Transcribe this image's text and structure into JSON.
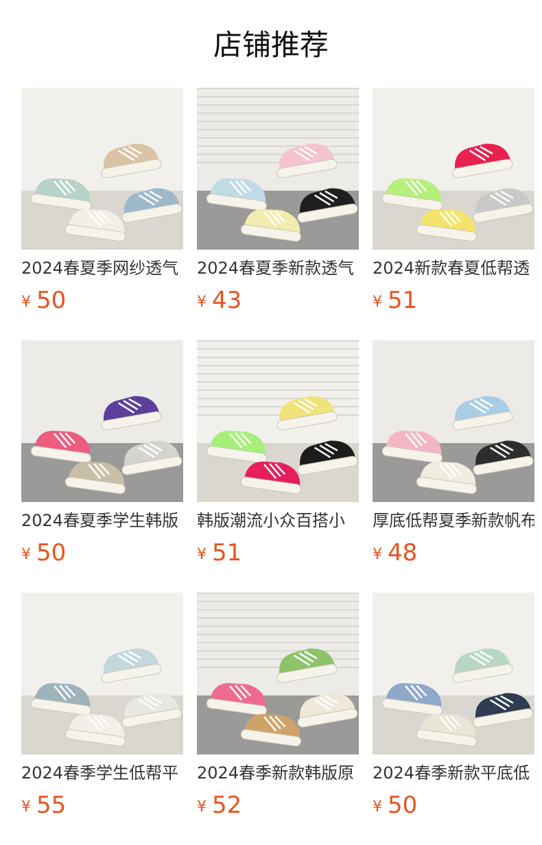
{
  "header": {
    "title": "店铺推荐"
  },
  "currency_symbol": "¥",
  "products": [
    {
      "name": "2024春夏季网纱透气",
      "price": "50",
      "image": "sneakers-pastel-pile-photo",
      "colors": [
        "#b7d3c9",
        "#d9c4a3",
        "#f2efe6",
        "#9db8c9"
      ]
    },
    {
      "name": "2024春夏季新款透气",
      "price": "43",
      "image": "canvas-sneakers-pile-photo",
      "colors": [
        "#bfdbe6",
        "#f4c3cf",
        "#f3ecb0",
        "#1f1f1f"
      ]
    },
    {
      "name": "2024新款春夏低帮透",
      "price": "51",
      "image": "colorful-sneakers-photo",
      "colors": [
        "#b5f07a",
        "#e8214f",
        "#f3e36a",
        "#c9c9c9"
      ]
    },
    {
      "name": "2024春夏季学生韩版",
      "price": "50",
      "image": "retro-sneakers-photo",
      "colors": [
        "#ee5c7f",
        "#5b3f9a",
        "#c9bfa8",
        "#d4d4d0"
      ]
    },
    {
      "name": "韩版潮流小众百搭小",
      "price": "51",
      "image": "neon-sneakers-photo",
      "colors": [
        "#a6ef7a",
        "#f1e27a",
        "#e71d5c",
        "#1c1c1c"
      ]
    },
    {
      "name": "厚底低帮夏季新款帆布",
      "price": "48",
      "image": "platform-canvas-sneakers-photo",
      "colors": [
        "#f3b6c4",
        "#a9cde4",
        "#f1ece0",
        "#2d2d2d"
      ]
    },
    {
      "name": "2024春季学生低帮平",
      "price": "55",
      "image": "grey-blue-sneaker-photo",
      "colors": [
        "#9fb3bd",
        "#c2d8de",
        "#f1efe8",
        "#e7e7e3"
      ]
    },
    {
      "name": "2024春季新款韩版原",
      "price": "52",
      "image": "kids-sneakers-photo",
      "colors": [
        "#ef6a8f",
        "#8fc36a",
        "#cfa367",
        "#efe8d9"
      ]
    },
    {
      "name": "2024春季新款平底低",
      "price": "50",
      "image": "suede-sneakers-photo",
      "colors": [
        "#8ea8c9",
        "#b9d8c4",
        "#eae5d6",
        "#2e3d52"
      ]
    }
  ]
}
